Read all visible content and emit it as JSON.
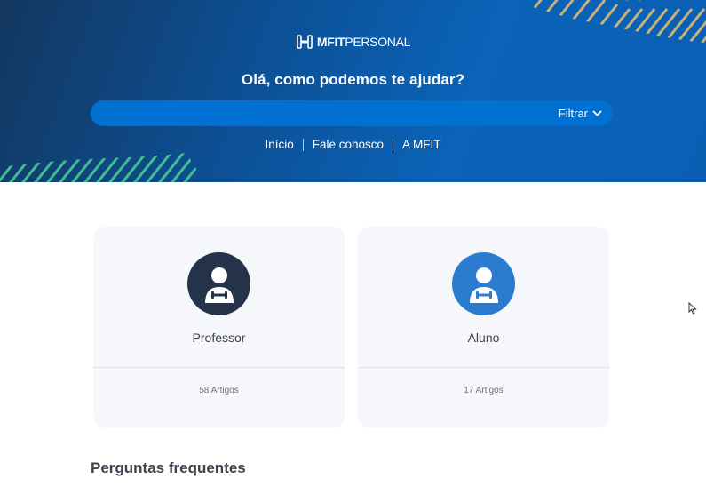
{
  "brand": {
    "logo_bold": "MFIT",
    "logo_light": "PERSONAL",
    "logo_icon": "dumbbell-logo-icon"
  },
  "hero": {
    "title": "Olá, como podemos te ajudar?",
    "search": {
      "value": "",
      "placeholder": "",
      "filter_label": "Filtrar",
      "filter_icon": "chevron-down-icon"
    },
    "nav": [
      {
        "label": "Início"
      },
      {
        "label": "Fale conosco"
      },
      {
        "label": "A MFIT"
      }
    ]
  },
  "categories": [
    {
      "title": "Professor",
      "count": "58 Artigos",
      "icon": "trainer-avatar-icon",
      "color": "#24324a"
    },
    {
      "title": "Aluno",
      "count": "17 Artigos",
      "icon": "student-avatar-icon",
      "color": "#2b7bd1"
    }
  ],
  "faq": {
    "title": "Perguntas frequentes"
  },
  "colors": {
    "hero_dark": "#13375f",
    "hero_blue": "#0a63b8",
    "search_bg": "#0070d2",
    "stripe_green": "#3fbf8f",
    "stripe_gold": "#c9b27a"
  }
}
